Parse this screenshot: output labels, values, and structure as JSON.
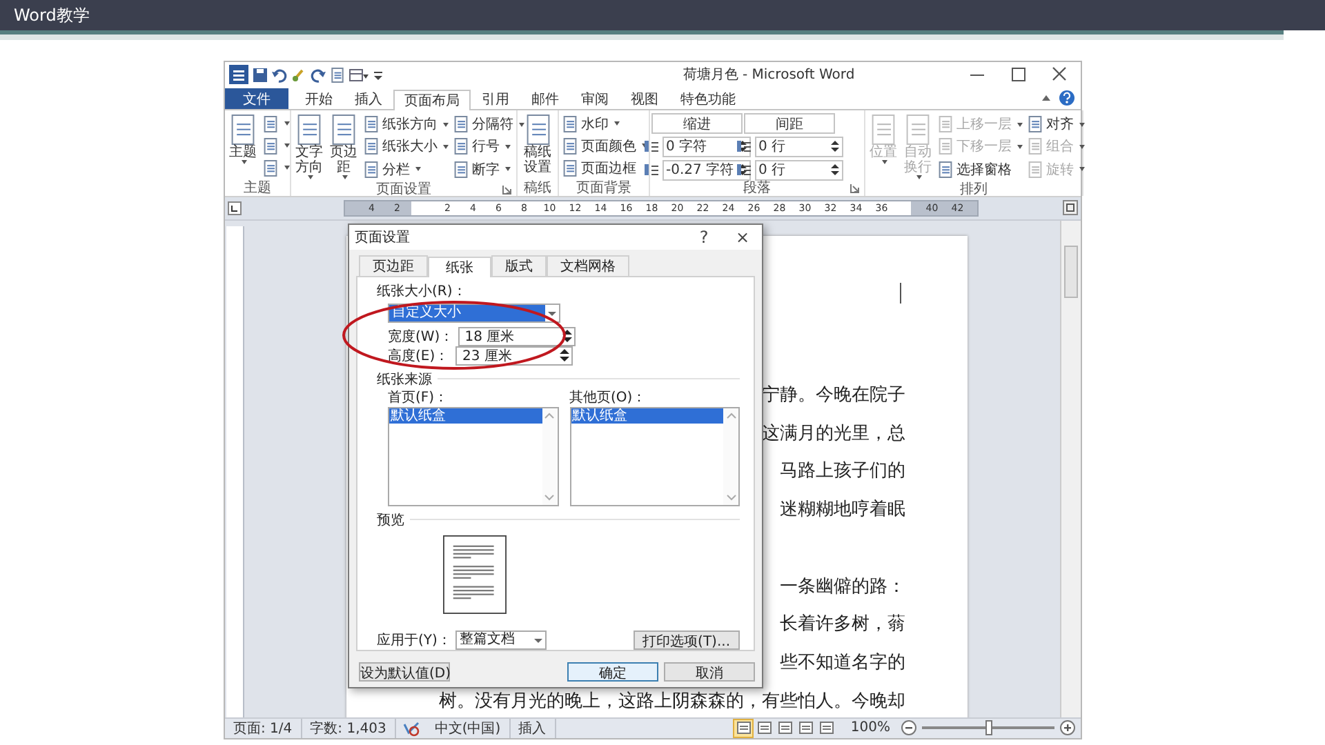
{
  "slide": {
    "title": "Word教学"
  },
  "window": {
    "title": "荷塘月色 - Microsoft Word"
  },
  "ribbon_tabs": [
    {
      "label": "文件",
      "kind": "file",
      "selected": false
    },
    {
      "label": "开始",
      "kind": "tab",
      "selected": false
    },
    {
      "label": "插入",
      "kind": "tab",
      "selected": false
    },
    {
      "label": "页面布局",
      "kind": "tab",
      "selected": true
    },
    {
      "label": "引用",
      "kind": "tab",
      "selected": false
    },
    {
      "label": "邮件",
      "kind": "tab",
      "selected": false
    },
    {
      "label": "审阅",
      "kind": "tab",
      "selected": false
    },
    {
      "label": "视图",
      "kind": "tab",
      "selected": false
    },
    {
      "label": "特色功能",
      "kind": "tab",
      "selected": false
    }
  ],
  "ribbon_groups": [
    {
      "label": "主题",
      "launcher": false,
      "columns": [
        {
          "kind": "large",
          "items": [
            {
              "label": "主题",
              "dropdown": true,
              "disabled": false
            }
          ]
        },
        {
          "kind": "small",
          "items": [
            {
              "dropdown": true,
              "disabled": false
            },
            {
              "dropdown": true,
              "disabled": false
            },
            {
              "dropdown": true,
              "disabled": false
            }
          ]
        }
      ]
    },
    {
      "label": "页面设置",
      "launcher": true,
      "columns": [
        {
          "kind": "large",
          "items": [
            {
              "label": "文字方向",
              "dropdown": true,
              "disabled": false
            }
          ]
        },
        {
          "kind": "large",
          "items": [
            {
              "label": "页边距",
              "dropdown": true,
              "disabled": false
            }
          ]
        },
        {
          "kind": "small",
          "items": [
            {
              "label": "纸张方向",
              "dropdown": true,
              "disabled": false
            },
            {
              "label": "纸张大小",
              "dropdown": true,
              "disabled": false
            },
            {
              "label": "分栏",
              "dropdown": true,
              "disabled": false
            }
          ]
        },
        {
          "kind": "small",
          "items": [
            {
              "label": "分隔符",
              "dropdown": true,
              "disabled": false
            },
            {
              "label": "行号",
              "dropdown": true,
              "disabled": false
            },
            {
              "label": "断字",
              "dropdown": true,
              "disabled": false
            }
          ]
        }
      ]
    },
    {
      "label": "稿纸",
      "launcher": false,
      "columns": [
        {
          "kind": "large",
          "items": [
            {
              "label": "稿纸设置",
              "dropdown": false,
              "disabled": false
            }
          ]
        }
      ]
    },
    {
      "label": "页面背景",
      "launcher": false,
      "columns": [
        {
          "kind": "small",
          "items": [
            {
              "label": "水印",
              "dropdown": true,
              "disabled": false
            },
            {
              "label": "页面颜色",
              "dropdown": true,
              "disabled": false
            },
            {
              "label": "页面边框",
              "dropdown": false,
              "disabled": false
            }
          ]
        }
      ]
    },
    {
      "label": "段落",
      "launcher": true,
      "columns": [
        {
          "kind": "spin",
          "label": "缩进",
          "items": [
            {
              "value": "0 字符"
            },
            {
              "value": "-0.27 字符"
            }
          ]
        },
        {
          "kind": "spin",
          "label": "间距",
          "items": [
            {
              "value": "0 行"
            },
            {
              "value": "0 行"
            }
          ]
        }
      ]
    },
    {
      "label": "排列",
      "launcher": false,
      "columns": [
        {
          "kind": "large",
          "items": [
            {
              "label": "位置",
              "dropdown": true,
              "disabled": true
            }
          ]
        },
        {
          "kind": "large",
          "items": [
            {
              "label": "自动换行",
              "dropdown": true,
              "disabled": true
            }
          ]
        },
        {
          "kind": "small",
          "items": [
            {
              "label": "上移一层",
              "dropdown": true,
              "disabled": true
            },
            {
              "label": "下移一层",
              "dropdown": true,
              "disabled": true
            },
            {
              "label": "选择窗格",
              "dropdown": false,
              "disabled": false
            }
          ]
        },
        {
          "kind": "small",
          "items": [
            {
              "label": "对齐",
              "dropdown": true,
              "disabled": false
            },
            {
              "label": "组合",
              "dropdown": true,
              "disabled": true
            },
            {
              "label": "旋转",
              "dropdown": true,
              "disabled": true
            }
          ]
        }
      ]
    }
  ],
  "ruler_labels": [
    "4",
    "2",
    "2",
    "4",
    "6",
    "8",
    "10",
    "12",
    "14",
    "16",
    "18",
    "20",
    "22",
    "24",
    "26",
    "28",
    "30",
    "32",
    "34",
    "36",
    "40",
    "42"
  ],
  "document_lines": [
    {
      "kind": "text",
      "text": "宁静。今晚在院子"
    },
    {
      "kind": "text",
      "text": "这满月的光里，总"
    },
    {
      "kind": "text",
      "text": "马路上孩子们的"
    },
    {
      "kind": "text",
      "text": "迷糊糊地哼着眠"
    },
    {
      "kind": "gap"
    },
    {
      "kind": "text",
      "text": "一条幽僻的路："
    },
    {
      "kind": "text",
      "text": "长着许多树，蓊"
    },
    {
      "kind": "text",
      "text": "些不知道名字的"
    },
    {
      "kind": "text",
      "text": "树。没有月光的晚上，这路上阴森森的，有些怕人。今晚却"
    }
  ],
  "dialog": {
    "title": "页面设置",
    "help": "?",
    "close": "×",
    "tabs": [
      {
        "label": "页边距",
        "selected": false
      },
      {
        "label": "纸张",
        "selected": true
      },
      {
        "label": "版式",
        "selected": false
      },
      {
        "label": "文档网格",
        "selected": false
      }
    ],
    "paper_size": {
      "label": "纸张大小(R)：",
      "value": "自定义大小"
    },
    "width": {
      "label": "宽度(W)：",
      "value": "18 厘米"
    },
    "height": {
      "label": "高度(E)：",
      "value": "23 厘米"
    },
    "source_label": "纸张来源",
    "first_page": {
      "label": "首页(F)：",
      "items": [
        {
          "text": "默认纸盒",
          "selected": true
        }
      ]
    },
    "other_pages": {
      "label": "其他页(O)：",
      "items": [
        {
          "text": "默认纸盒",
          "selected": true
        }
      ]
    },
    "preview_label": "预览",
    "apply_to": {
      "label": "应用于(Y)：",
      "value": "整篇文档"
    },
    "print_options": "打印选项(T)...",
    "buttons": [
      {
        "label": "设为默认值(D)",
        "kind": "plain"
      },
      {
        "label": "确定",
        "kind": "default"
      },
      {
        "label": "取消",
        "kind": "plain"
      }
    ]
  },
  "annotations": [
    {
      "kind": "ellipse"
    }
  ],
  "status_bar": {
    "items": [
      "页面: 1/4",
      "字数: 1,403"
    ],
    "language": "中文(中国)",
    "mode": "插入",
    "views": [
      {
        "selected": true
      },
      {
        "selected": false
      },
      {
        "selected": false
      },
      {
        "selected": false
      },
      {
        "selected": false
      }
    ],
    "zoom": {
      "reading": "100%",
      "level": 0.5
    }
  }
}
